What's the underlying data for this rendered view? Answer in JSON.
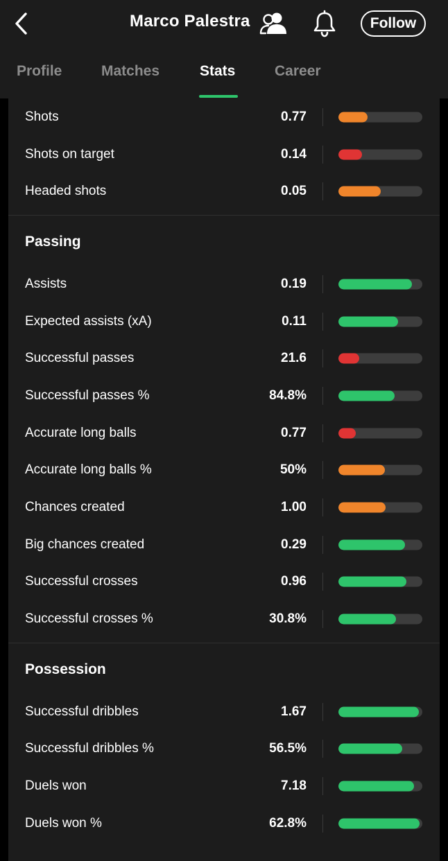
{
  "header": {
    "player_name": "Marco Palestra",
    "follow_label": "Follow",
    "back_icon": "chevron-left-icon",
    "people_icon": "people-icon",
    "bell_icon": "bell-icon"
  },
  "tabs": [
    {
      "label": "Profile",
      "active": false
    },
    {
      "label": "Matches",
      "active": false
    },
    {
      "label": "Stats",
      "active": true
    },
    {
      "label": "Career",
      "active": false
    }
  ],
  "colors": {
    "green": "#2ec46b",
    "orange": "#f0852b",
    "red": "#e03434",
    "indicator": "#2ec46b"
  },
  "sections": [
    {
      "title": "",
      "rows": [
        {
          "label": "Shots",
          "value": "0.77",
          "level": 0.35,
          "color": "orange"
        },
        {
          "label": "Shots on target",
          "value": "0.14",
          "level": 0.28,
          "color": "red"
        },
        {
          "label": "Headed shots",
          "value": "0.05",
          "level": 0.5,
          "color": "orange"
        }
      ]
    },
    {
      "title": "Passing",
      "rows": [
        {
          "label": "Assists",
          "value": "0.19",
          "level": 0.88,
          "color": "green"
        },
        {
          "label": "Expected assists (xA)",
          "value": "0.11",
          "level": 0.71,
          "color": "green"
        },
        {
          "label": "Successful passes",
          "value": "21.6",
          "level": 0.25,
          "color": "red"
        },
        {
          "label": "Successful passes %",
          "value": "84.8%",
          "level": 0.67,
          "color": "green"
        },
        {
          "label": "Accurate long balls",
          "value": "0.77",
          "level": 0.21,
          "color": "red"
        },
        {
          "label": "Accurate long balls %",
          "value": "50%",
          "level": 0.55,
          "color": "orange"
        },
        {
          "label": "Chances created",
          "value": "1.00",
          "level": 0.56,
          "color": "orange"
        },
        {
          "label": "Big chances created",
          "value": "0.29",
          "level": 0.79,
          "color": "green"
        },
        {
          "label": "Successful crosses",
          "value": "0.96",
          "level": 0.81,
          "color": "green"
        },
        {
          "label": "Successful crosses %",
          "value": "30.8%",
          "level": 0.69,
          "color": "green"
        }
      ]
    },
    {
      "title": "Possession",
      "rows": [
        {
          "label": "Successful dribbles",
          "value": "1.67",
          "level": 0.96,
          "color": "green"
        },
        {
          "label": "Successful dribbles %",
          "value": "56.5%",
          "level": 0.76,
          "color": "green"
        },
        {
          "label": "Duels won",
          "value": "7.18",
          "level": 0.9,
          "color": "green"
        },
        {
          "label": "Duels won %",
          "value": "62.8%",
          "level": 0.97,
          "color": "green"
        }
      ]
    }
  ]
}
